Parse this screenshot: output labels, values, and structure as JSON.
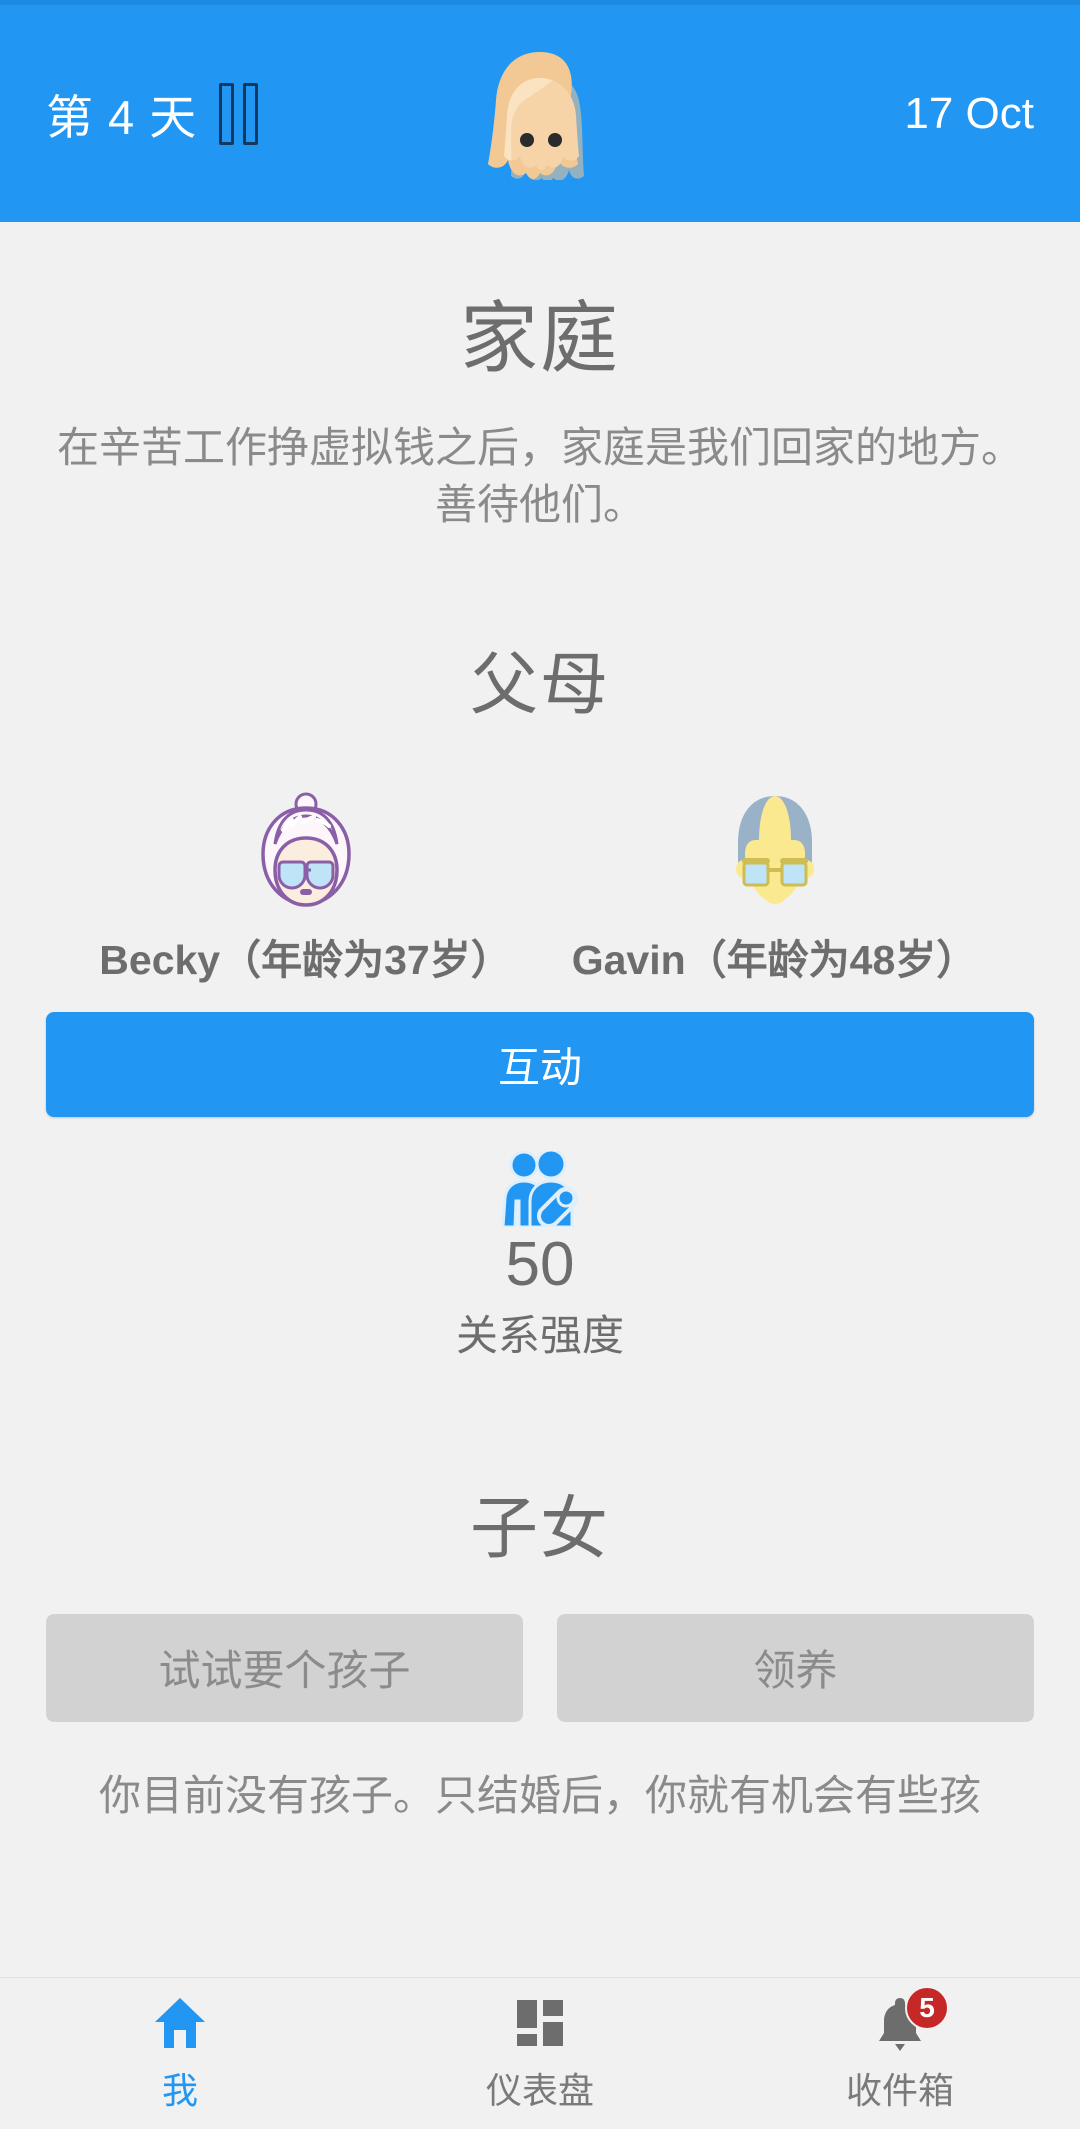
{
  "header": {
    "day_label": "第 4 天",
    "pause_icon": "pause-icon",
    "avatar_icon": "player-avatar-blonde-woman",
    "date": "17 Oct",
    "bar_color": "#2196f3"
  },
  "main": {
    "title": "家庭",
    "description": "在辛苦工作挣虚拟钱之后，家庭是我们回家的地方。善待他们。",
    "parents": {
      "section_title": "父母",
      "members": [
        {
          "name_label": "Becky（年龄为37岁）",
          "avatar_icon": "grandmother-face-icon"
        },
        {
          "name_label": "Gavin（年龄为48岁）",
          "avatar_icon": "grandfather-face-icon"
        }
      ],
      "interact_button": "互动",
      "stat": {
        "icon": "family-relationship-icon",
        "value": "50",
        "label": "关系强度"
      }
    },
    "children": {
      "section_title": "子女",
      "try_baby_button": "试试要个孩子",
      "adopt_button": "领养",
      "note": "你目前没有孩子。只结婚后，你就有机会有些孩"
    }
  },
  "bottom_nav": {
    "items": [
      {
        "label": "我",
        "icon": "home-icon",
        "active": true,
        "badge": ""
      },
      {
        "label": "仪表盘",
        "icon": "dashboard-grid-icon",
        "active": false,
        "badge": ""
      },
      {
        "label": "收件箱",
        "icon": "bell-icon",
        "active": false,
        "badge": "5"
      }
    ]
  },
  "colors": {
    "accent": "#2196f3",
    "background": "#f1f1f1",
    "text_muted": "#6d6d6d",
    "badge_red": "#c62828",
    "secondary_button": "#d2d2d2"
  }
}
